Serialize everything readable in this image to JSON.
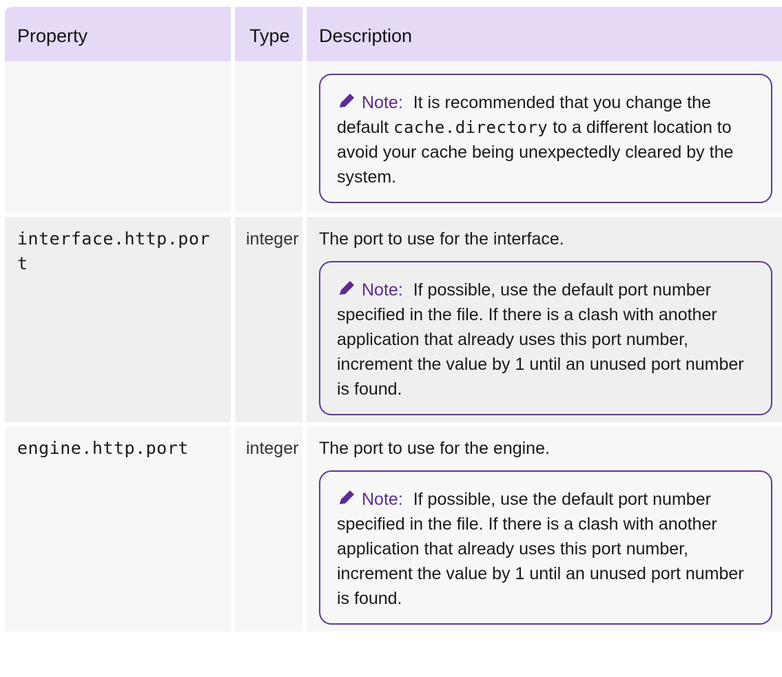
{
  "table": {
    "headers": {
      "property": "Property",
      "type": "Type",
      "description": "Description"
    },
    "rows": [
      {
        "property": "",
        "type": "",
        "description": "",
        "note": {
          "label": "Note",
          "text_before": "It is recommended that you change the default",
          "code": "cache.directory",
          "text_after": "to a different location to avoid your cache being unexpectedly cleared by the system."
        }
      },
      {
        "property": "interface.http.port",
        "type": "integer",
        "description": "The port to use for the interface.",
        "note": {
          "label": "Note",
          "text": "If possible, use the default port number specified in the file. If there is a clash with another application that already uses this port number, increment the value by 1 until an unused port number is found."
        }
      },
      {
        "property": "engine.http.port",
        "type": "integer",
        "description": "The port to use for the engine.",
        "note": {
          "label": "Note",
          "text": "If possible, use the default port number specified in the file. If there is a clash with another application that already uses this port number, increment the value by 1 until an unused port number is found."
        }
      }
    ]
  },
  "colors": {
    "header_background": "#e6d9f6",
    "note_border": "#5b3a91",
    "note_label": "#5b2c92"
  },
  "icons": {
    "note_icon": "pencil-icon"
  }
}
